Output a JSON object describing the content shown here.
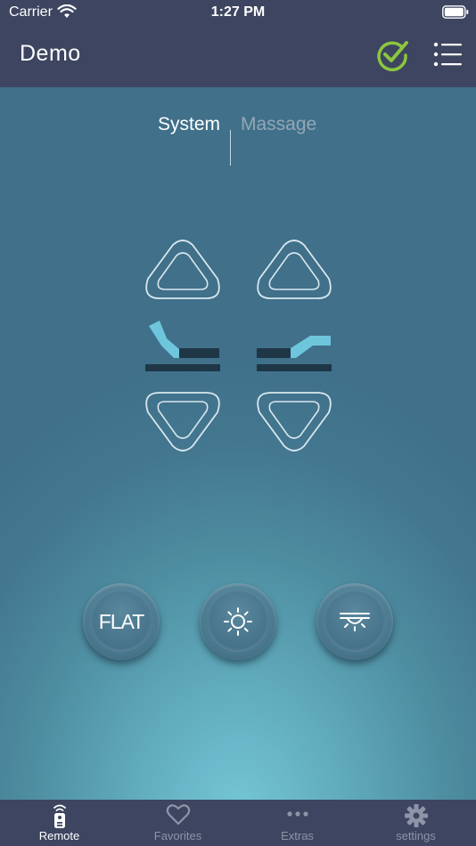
{
  "status_bar": {
    "carrier": "Carrier",
    "time": "1:27 PM"
  },
  "nav": {
    "title": "Demo",
    "check_icon": "check-circle-icon",
    "menu_icon": "list-menu-icon"
  },
  "segment": {
    "options": [
      "System",
      "Massage"
    ],
    "selected": "System"
  },
  "controls": {
    "head_up_icon": "triangle-up-icon",
    "head_down_icon": "triangle-down-icon",
    "foot_up_icon": "triangle-up-icon",
    "foot_down_icon": "triangle-down-icon",
    "head_icon": "bed-head-raise-icon",
    "foot_icon": "bed-foot-raise-icon"
  },
  "buttons": {
    "flat_label": "FLAT",
    "light_icon": "sun-icon",
    "underbed_icon": "underbed-light-icon"
  },
  "tabs": [
    {
      "label": "Remote",
      "icon": "remote-icon",
      "active": true
    },
    {
      "label": "Favorites",
      "icon": "heart-icon",
      "active": false
    },
    {
      "label": "Extras",
      "icon": "ellipsis-icon",
      "active": false
    },
    {
      "label": "settings",
      "icon": "gear-icon",
      "active": false
    }
  ],
  "colors": {
    "nav_background": "#3d4560",
    "accent_green": "#8cc63f",
    "accent_cyan": "#6ec6dc",
    "dark_bar": "#1f3646"
  }
}
